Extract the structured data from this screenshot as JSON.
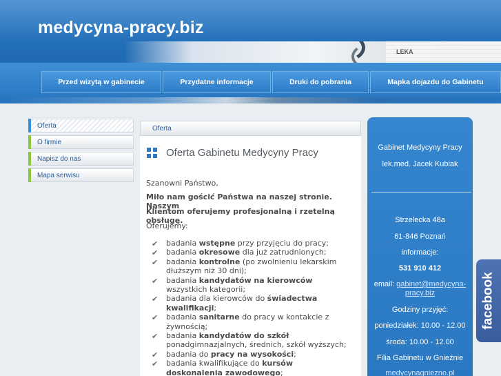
{
  "site": {
    "title": "medycyna-pracy.biz"
  },
  "header": {
    "photo_text": "LEKA"
  },
  "nav": {
    "tabs": [
      {
        "label": "Przed wizytą w gabinecie"
      },
      {
        "label": "Przydatne informacje"
      },
      {
        "label": "Druki do pobrania"
      },
      {
        "label": "Mapka dojazdu do Gabinetu"
      }
    ]
  },
  "sidebar": {
    "items": [
      {
        "label": "Oferta",
        "color": "#3a8fd8"
      },
      {
        "label": "O firmie",
        "color": "#8dc63f"
      },
      {
        "label": "Napisz do nas",
        "color": "#8dc63f"
      },
      {
        "label": "Mapa serwisu",
        "color": "#8dc63f"
      }
    ]
  },
  "breadcrumb": "Oferta",
  "content": {
    "heading": "Oferta Gabinetu Medycyny Pracy",
    "greeting": "Szanowni Państwo,",
    "intro_bold_1": "Miło nam gościć Państwa na naszej stronie. Naszym",
    "intro_bold_2": "Klientom oferujemy profesjonalną i rzetelną obsługę.",
    "offer_label": "Oferujemy:",
    "services": [
      {
        "a": "badania ",
        "b": "wstępne",
        "c": " przy przyjęciu do pracy;"
      },
      {
        "a": "badania ",
        "b": "okresowe",
        "c": " dla już zatrudnionych;"
      },
      {
        "a": "badania ",
        "b": "kontrolne",
        "c": " (po zwolnieniu lekarskim dłuższym niż 30 dni);"
      },
      {
        "a": "badania ",
        "b": "kandydatów na kierowców",
        "c": " wszystkich kategorii;"
      },
      {
        "a": "badania dla kierowców do ",
        "b": "świadectwa kwalifikacji",
        "c": ";"
      },
      {
        "a": "badania ",
        "b": "sanitarne",
        "c": " do pracy w kontakcie z żywnością;"
      },
      {
        "a": "badania ",
        "b": "kandydatów do szkół",
        "c": " ponadgimnazjalnych, średnich, szkół wyższych;"
      },
      {
        "a": "badania do ",
        "b": "pracy na wysokości",
        "c": ";"
      },
      {
        "a": "badania  kwalifikujące do ",
        "b": "kursów doskonalenia zawodowego",
        "c": ";"
      }
    ]
  },
  "contact": {
    "name": "Gabinet Medycyny Pracy",
    "doctor": "lek.med. Jacek Kubiak",
    "street": "Strzelecka 48a",
    "city": "61-846 Poznań",
    "info_label": "informacje:",
    "phone": "531 910 412",
    "email_label": "email: ",
    "email_1": "gabinet@medycyna-",
    "email_2": "pracy.biz",
    "hours_label": "Godziny przyjęć:",
    "monday": "poniedziałek: 10.00 - 12.00",
    "wednesday": "środa: 10.00 - 12.00",
    "branch": "Filia Gabinetu w Gnieźnie",
    "branch_link": "medycynagniezno.pl"
  },
  "facebook": {
    "label": "facebook",
    "color": "#3b5998"
  }
}
